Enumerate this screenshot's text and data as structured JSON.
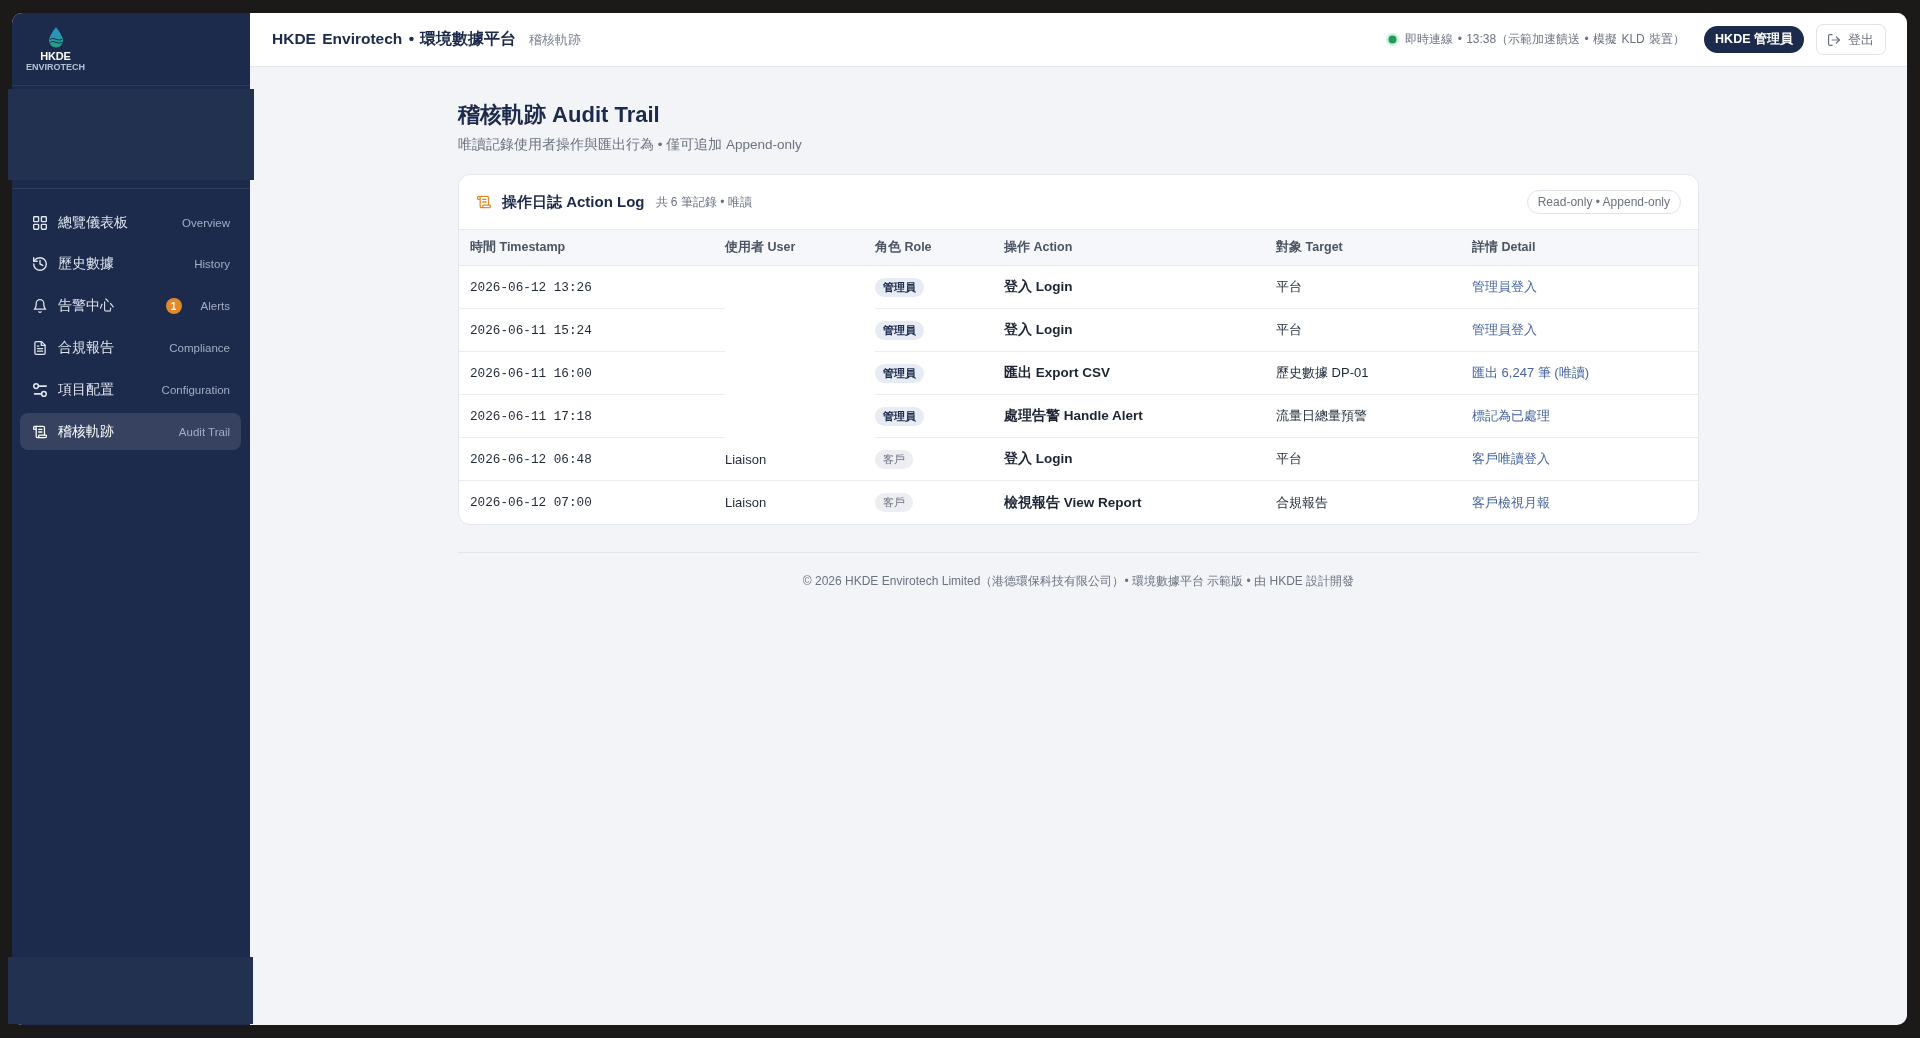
{
  "sidebar": {
    "logo": {
      "name": "HKDE",
      "tagline": "ENVIROTECH"
    },
    "items": [
      {
        "label": "總覽儀表板",
        "sublabel": "Overview",
        "selected": false
      },
      {
        "label": "歷史數據",
        "sublabel": "History",
        "selected": false
      },
      {
        "label": "告警中心",
        "sublabel": "Alerts",
        "badge": "1",
        "selected": false
      },
      {
        "label": "合規報告",
        "sublabel": "Compliance",
        "selected": false
      },
      {
        "label": "項目配置",
        "sublabel": "Configuration",
        "selected": false
      },
      {
        "label": "稽核軌跡",
        "sublabel": "Audit Trail",
        "selected": true
      }
    ]
  },
  "header": {
    "title": "HKDE Envirotech • 環境數據平台",
    "breadcrumb": "稽核軌跡",
    "status": {
      "online": true,
      "text": "即時連線 • 13:38（示範加速饋送 • 模擬 KLD 裝置）"
    },
    "user_button": "HKDE 管理員",
    "logout_button": "登出"
  },
  "page": {
    "title": "稽核軌跡 Audit Trail",
    "subtitle": "唯讀記錄使用者操作與匯出行為 • 僅可追加 Append-only"
  },
  "action_log": {
    "title": "操作日誌 Action Log",
    "meta": "共 6 筆記錄 • 唯讀",
    "tag": "Read-only • Append-only",
    "columns": [
      "時間 Timestamp",
      "使用者 User",
      "角色 Role",
      "操作 Action",
      "對象 Target",
      "詳情 Detail"
    ],
    "rows": [
      {
        "timestamp": "2026-06-12 13:26",
        "role": {
          "label": "管理員",
          "kind": "admin"
        },
        "action": "登入 Login",
        "target": "平台",
        "detail": "管理員登入"
      },
      {
        "timestamp": "2026-06-11 15:24",
        "role": {
          "label": "管理員",
          "kind": "admin"
        },
        "action": "登入 Login",
        "target": "平台",
        "detail": "管理員登入"
      },
      {
        "timestamp": "2026-06-11 16:00",
        "role": {
          "label": "管理員",
          "kind": "admin"
        },
        "action": "匯出 Export CSV",
        "target": "歷史數據 DP-01",
        "detail": "匯出 6,247 筆 (唯讀)"
      },
      {
        "timestamp": "2026-06-11 17:18",
        "role": {
          "label": "管理員",
          "kind": "admin"
        },
        "action": "處理告警 Handle Alert",
        "target": "流量日總量預警",
        "detail": "標記為已處理"
      },
      {
        "timestamp": "2026-06-12 06:48",
        "user": "Liaison",
        "role": {
          "label": "客戶",
          "kind": "client"
        },
        "action": "登入 Login",
        "target": "平台",
        "detail": "客戶唯讀登入"
      },
      {
        "timestamp": "2026-06-12 07:00",
        "user": "Liaison",
        "role": {
          "label": "客戶",
          "kind": "client"
        },
        "action": "檢視報告 View Report",
        "target": "合規報告",
        "detail": "客戶檢視月報"
      }
    ]
  },
  "footer": "© 2026 HKDE Envirotech Limited（港德環保科技有限公司）• 環境數據平台 示範版 • 由 HKDE 設計開發"
}
